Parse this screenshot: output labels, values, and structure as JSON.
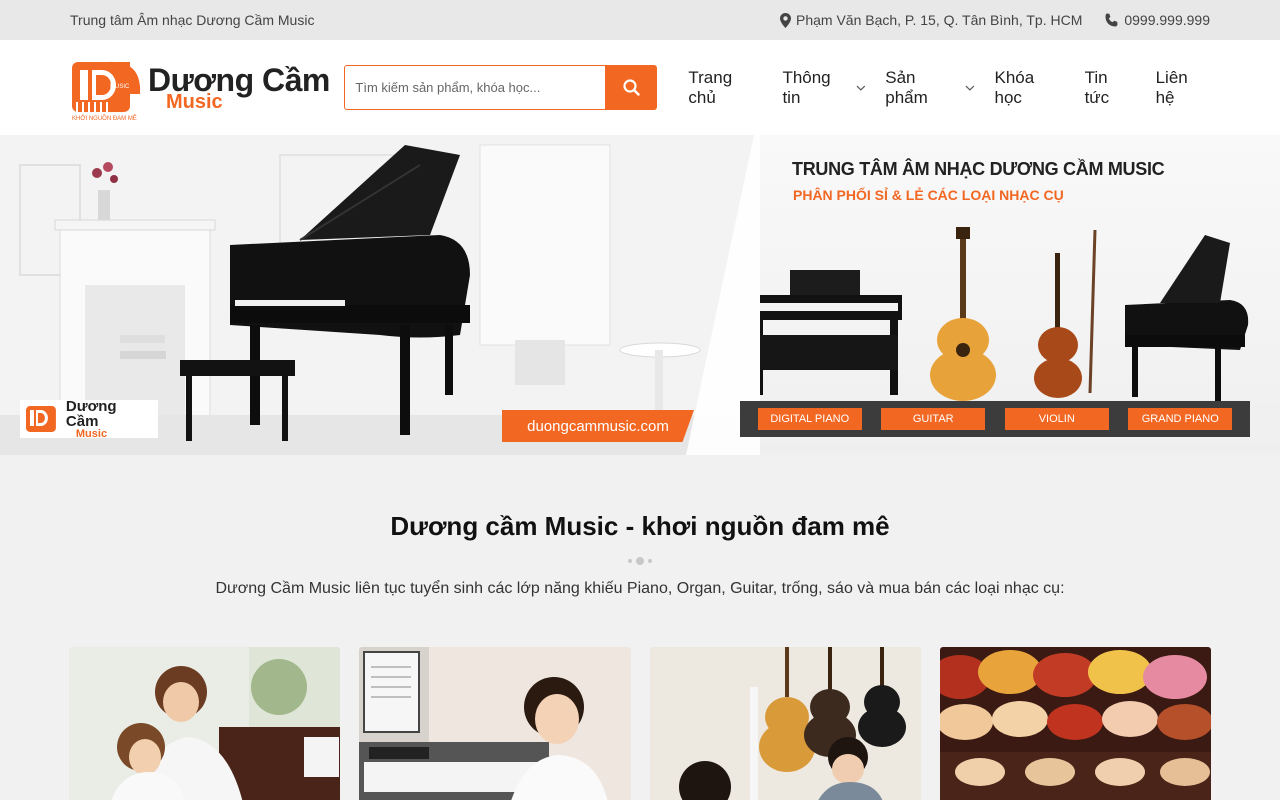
{
  "topbar": {
    "site_name": "Trung tâm Âm nhạc Dương Cầm Music",
    "address": "Phạm Văn Bạch, P. 15, Q. Tân Bình, Tp. HCM",
    "phone": "0999.999.999"
  },
  "header": {
    "logo_name": "Dương Cầm",
    "logo_sub": "Music",
    "logo_mark_text": "MUSIC",
    "logo_tagline": "KHỞI NGUỒN ĐAM MÊ",
    "search_placeholder": "Tìm kiếm sản phẩm, khóa học...",
    "nav": [
      {
        "label": "Trang chủ",
        "has_dropdown": false
      },
      {
        "label": "Thông tin",
        "has_dropdown": true
      },
      {
        "label": "Sản phẩm",
        "has_dropdown": true
      },
      {
        "label": "Khóa học",
        "has_dropdown": false
      },
      {
        "label": "Tin tức",
        "has_dropdown": false
      },
      {
        "label": "Liên hệ",
        "has_dropdown": false
      }
    ]
  },
  "banner": {
    "title": "TRUNG TÂM ÂM NHẠC DƯƠNG CẦM MUSIC",
    "subtitle": "PHÂN PHỐI SỈ & LẺ CÁC LOẠI NHẠC CỤ",
    "url": "duongcammusic.com",
    "logo_name": "Dương Cầm",
    "logo_sub": "Music",
    "categories": [
      "DIGITAL PIANO",
      "GUITAR",
      "VIOLIN",
      "GRAND PIANO"
    ]
  },
  "section": {
    "title": "Dương cầm Music - khơi nguồn đam mê",
    "description": "Dương Cầm Music liên tục tuyển sinh các lớp năng khiếu Piano, Organ, Guitar, trống, sáo và mua bán các loại nhạc cụ:"
  },
  "colors": {
    "accent": "#f26722",
    "topbar_bg": "#e8e8e8",
    "page_bg": "#f1f1f1"
  },
  "icons": {
    "address": "map-pin-icon",
    "phone": "phone-icon",
    "search": "search-icon",
    "dropdown": "chevron-down-icon"
  }
}
